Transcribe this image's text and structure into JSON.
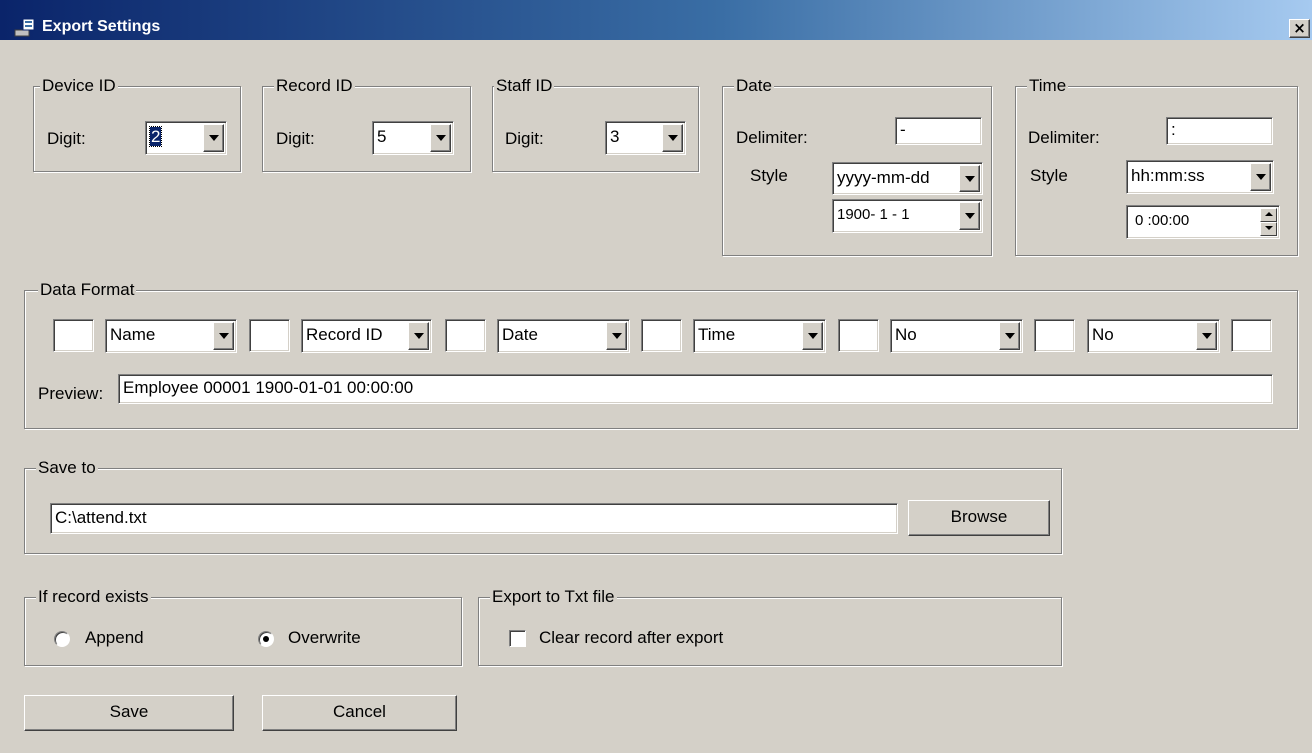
{
  "window": {
    "title": "Export Settings",
    "close_glyph": "×"
  },
  "device_id": {
    "legend": "Device ID",
    "digit_label": "Digit:",
    "value": "2"
  },
  "record_id": {
    "legend": "Record ID",
    "digit_label": "Digit:",
    "value": "5"
  },
  "staff_id": {
    "legend": "Staff ID",
    "digit_label": "Digit:",
    "value": "3"
  },
  "date": {
    "legend": "Date",
    "delimiter_label": "Delimiter:",
    "delimiter_value": "-",
    "style_label": "Style",
    "style_value": "yyyy-mm-dd",
    "start_value": "1900- 1 - 1"
  },
  "time": {
    "legend": "Time",
    "delimiter_label": "Delimiter:",
    "delimiter_value": ":",
    "style_label": "Style",
    "style_value": "hh:mm:ss",
    "start_value": "0 :00:00"
  },
  "data_format": {
    "legend": "Data Format",
    "fields": [
      "Name",
      "Record ID",
      "Date",
      "Time",
      "No",
      "No"
    ],
    "preview_label": "Preview:",
    "preview_value": "Employee  00001  1900-01-01  00:00:00"
  },
  "save_to": {
    "legend": "Save to",
    "path": "C:\\attend.txt",
    "browse_label": "Browse"
  },
  "if_exists": {
    "legend": "If record exists",
    "append_label": "Append",
    "overwrite_label": "Overwrite",
    "selected": "Overwrite"
  },
  "export_txt": {
    "legend": "Export to Txt file",
    "clear_label": "Clear record after export",
    "clear_checked": false
  },
  "buttons": {
    "save_label": "Save",
    "cancel_label": "Cancel"
  }
}
